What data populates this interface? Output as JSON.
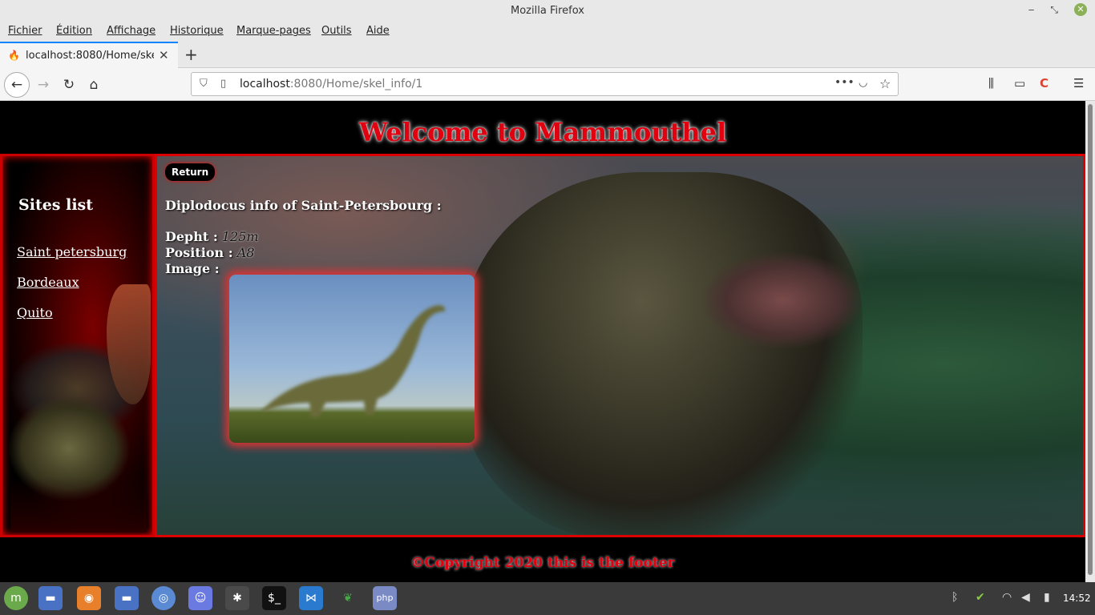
{
  "window": {
    "title": "Mozilla Firefox"
  },
  "menu": [
    "Fichier",
    "Édition",
    "Affichage",
    "Historique",
    "Marque-pages",
    "Outils",
    "Aide"
  ],
  "tab": {
    "title": "localhost:8080/Home/skel_"
  },
  "urlbar": {
    "host": "localhost",
    "rest": ":8080/Home/skel_info/1"
  },
  "page": {
    "heading": "Welcome to Mammouthel",
    "sidebar": {
      "title": "Sites list",
      "links": [
        "Saint petersburg",
        "Bordeaux",
        "Quito"
      ]
    },
    "return_label": "Return",
    "info_title": "Diplodocus info of Saint-Petersbourg :",
    "depth_label": "Depht :",
    "depth_value": "125m",
    "position_label": "Position :",
    "position_value": "A8",
    "image_label": "Image :",
    "footer": "©Copyright 2020 this is the footer"
  },
  "taskbar": {
    "clock": "14:52"
  },
  "colors": {
    "accent_red": "#e00010",
    "border_red": "#d00",
    "tab_accent": "#0a84ff"
  }
}
